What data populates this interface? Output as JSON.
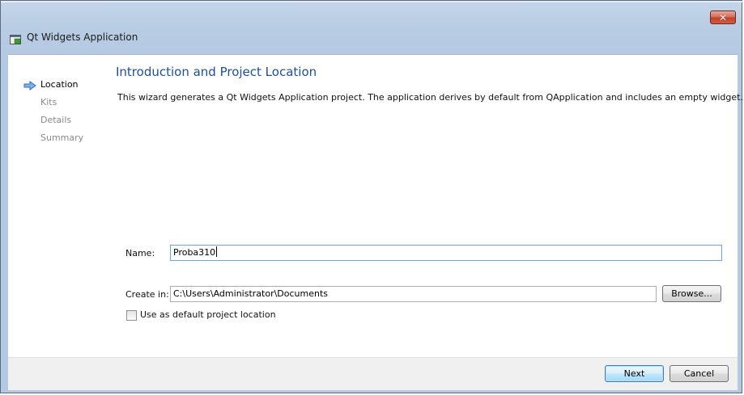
{
  "window": {
    "title": "Qt Widgets Application",
    "close_label": "✕"
  },
  "steps": [
    {
      "label": "Location",
      "active": true
    },
    {
      "label": "Kits",
      "active": false
    },
    {
      "label": "Details",
      "active": false
    },
    {
      "label": "Summary",
      "active": false
    }
  ],
  "page": {
    "title": "Introduction and Project Location",
    "description": "This wizard generates a Qt Widgets Application project. The application derives by default from QApplication and includes an empty widget."
  },
  "form": {
    "name_label": "Name:",
    "name_value": "Proba310",
    "create_in_label": "Create in:",
    "create_in_value": "C:\\Users\\Administrator\\Documents",
    "browse_label": "Browse...",
    "default_location_label": "Use as default project location",
    "default_location_checked": false
  },
  "footer": {
    "next_label": "Next",
    "cancel_label": "Cancel"
  },
  "icons": {
    "app": "qt-app-window-icon",
    "current_step": "right-arrow-icon",
    "close": "close-icon"
  },
  "colors": {
    "title_blue": "#1f4e9c",
    "frame_blue": "#b9cde4",
    "close_red": "#c2402a",
    "inactive_step": "#8a8a8a"
  }
}
